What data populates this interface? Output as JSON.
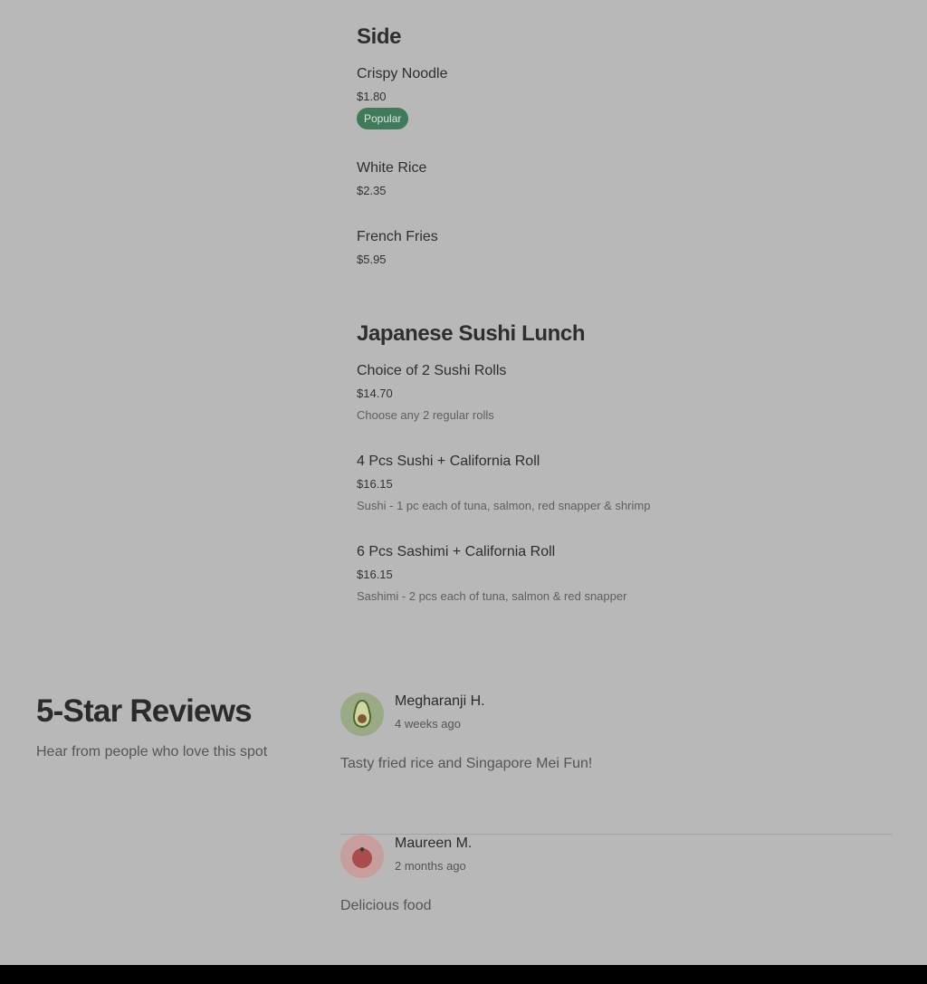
{
  "menu": {
    "categories": [
      {
        "title": "Side",
        "items": [
          {
            "name": "Crispy Noodle",
            "price": "$1.80",
            "badge": "Popular"
          },
          {
            "name": "White Rice",
            "price": "$2.35"
          },
          {
            "name": "French Fries",
            "price": "$5.95"
          }
        ]
      },
      {
        "title": "Japanese Sushi Lunch",
        "items": [
          {
            "name": "Choice of 2 Sushi Rolls",
            "price": "$14.70",
            "description": "Choose any 2 regular rolls"
          },
          {
            "name": "4 Pcs Sushi + California Roll",
            "price": "$16.15",
            "description": "Sushi - 1 pc each of tuna, salmon, red snapper & shrimp"
          },
          {
            "name": "6 Pcs Sashimi + California Roll",
            "price": "$16.15",
            "description": "Sashimi - 2 pcs each of tuna, salmon & red snapper"
          }
        ]
      }
    ]
  },
  "reviews": {
    "heading": "5-Star Reviews",
    "subheading": "Hear from people who love this spot",
    "items": [
      {
        "name": "Megharanji H.",
        "date": "4 weeks ago",
        "text": "Tasty fried rice and Singapore Mei Fun!",
        "avatar_icon": "avocado-icon"
      },
      {
        "name": "Maureen M.",
        "date": "2 months ago",
        "text": "Delicious food",
        "avatar_icon": "tomato-icon"
      }
    ]
  },
  "colors": {
    "page_background": "#b8b8b8",
    "badge_background": "#3f7a59",
    "footer": "#000000"
  }
}
